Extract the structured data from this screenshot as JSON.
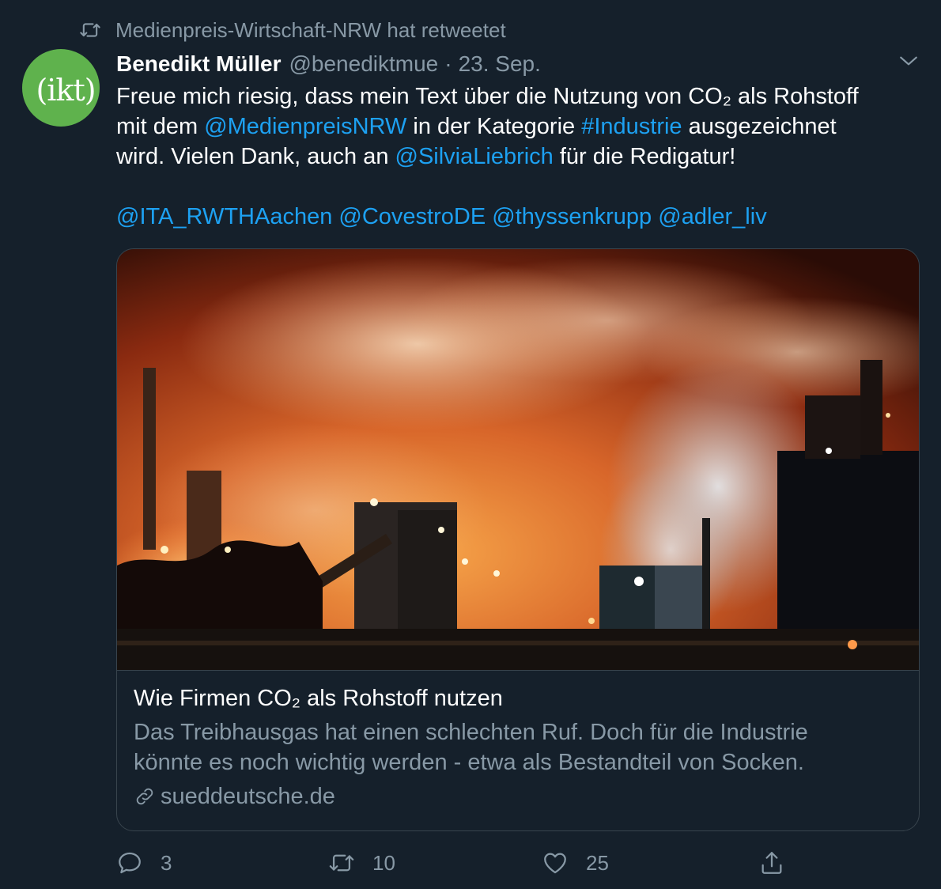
{
  "retweet_context": {
    "text": "Medienpreis-Wirtschaft-NRW hat retweetet",
    "icon": "retweet-icon"
  },
  "author": {
    "avatar_text": "(ikt)",
    "avatar_color": "#5fb24d",
    "name": "Benedikt Müller",
    "handle": "@benediktmue",
    "separator": "·",
    "date": "23. Sep."
  },
  "tweet": {
    "line1": "Freue mich riesig, dass mein Text über die Nutzung von CO₂ als Rohstoff",
    "line2_a": "mit dem ",
    "line2_mention": "@MedienpreisNRW",
    "line2_b": " in der Kategorie ",
    "line2_hashtag": "#Industrie",
    "line2_c": " ausgezeichnet",
    "line3_a": "wird. Vielen Dank, auch an ",
    "line3_mention": "@SilviaLiebrich",
    "line3_b": " für die Redigatur!",
    "mentions": [
      "@ITA_RWTHAachen",
      "@CovestroDE",
      "@thyssenkrupp",
      "@adler_liv"
    ]
  },
  "card": {
    "title": "Wie Firmen CO₂ als Rohstoff nutzen",
    "description_line1": "Das Treibhausgas hat einen schlechten Ruf. Doch für die Industrie",
    "description_line2": "könnte es noch wichtig werden - etwa als Bestandteil von Socken.",
    "domain": "sueddeutsche.de"
  },
  "actions": {
    "reply_count": "3",
    "retweet_count": "10",
    "like_count": "25"
  },
  "colors": {
    "background": "#15202b",
    "link": "#1da1f2",
    "secondary_text": "#8899a6",
    "border": "#38444d"
  }
}
